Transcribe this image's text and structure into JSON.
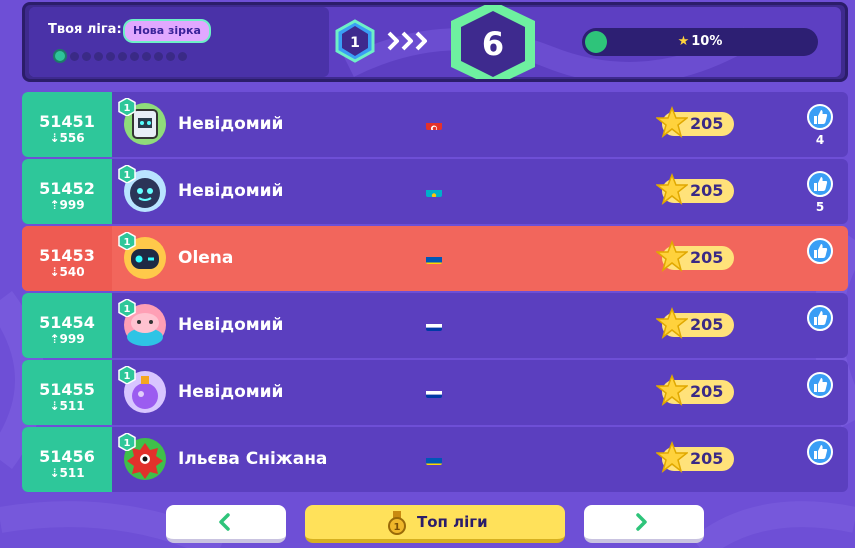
{
  "header": {
    "league_label": "Твоя ліга:",
    "league_name": "Нова зірка",
    "current_level": "1",
    "target_level": "6",
    "progress_text": "10%",
    "progress_value": 0.1,
    "progress_dots": 11,
    "colors": {
      "accent": "#2ec79a",
      "me": "#f2665c",
      "score": "#ffe27a"
    }
  },
  "rows": [
    {
      "rank": "51451",
      "delta": "556",
      "delta_dir": "down",
      "name": "Невідомий",
      "level": "1",
      "avatar": "robot-avatar",
      "flag": "tunisia-flag",
      "score": "205",
      "likes": "4"
    },
    {
      "rank": "51452",
      "delta": "999",
      "delta_dir": "up",
      "name": "Невідомий",
      "level": "1",
      "avatar": "ice-ball-avatar",
      "flag": "kazakhstan-flag",
      "score": "205",
      "likes": "5"
    },
    {
      "rank": "51453",
      "delta": "540",
      "delta_dir": "down",
      "name": "Olena",
      "level": "1",
      "avatar": "winking-bot-avatar",
      "flag": "ukraine-flag",
      "score": "205",
      "likes": "",
      "me": true
    },
    {
      "rank": "51454",
      "delta": "999",
      "delta_dir": "up",
      "name": "Невідомий",
      "level": "1",
      "avatar": "pink-creature-avatar",
      "flag": "russia-flag",
      "score": "205",
      "likes": ""
    },
    {
      "rank": "51455",
      "delta": "511",
      "delta_dir": "down",
      "name": "Невідомий",
      "level": "1",
      "avatar": "potion-avatar",
      "flag": "russia-flag",
      "score": "205",
      "likes": ""
    },
    {
      "rank": "51456",
      "delta": "511",
      "delta_dir": "down",
      "name": "Ільєва Сніжана",
      "level": "1",
      "avatar": "red-monster-avatar",
      "flag": "ukraine-flag",
      "score": "205",
      "likes": ""
    }
  ],
  "nav": {
    "top_label": "Топ ліги",
    "prev_icon": "chevron-left-icon",
    "next_icon": "chevron-right-icon"
  }
}
